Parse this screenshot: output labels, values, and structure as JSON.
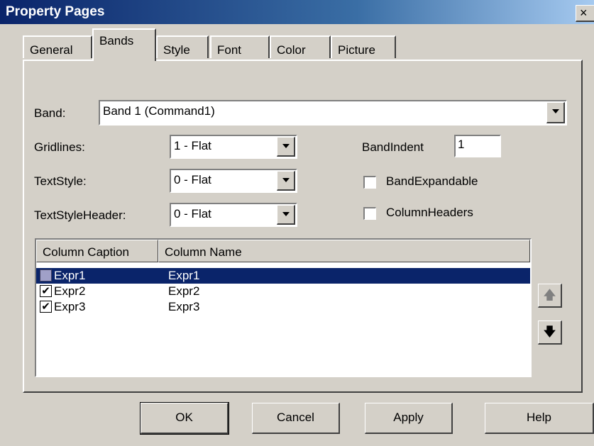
{
  "window": {
    "title": "Property Pages",
    "close_glyph": "×"
  },
  "tabs": [
    {
      "label": "General"
    },
    {
      "label": "Bands",
      "active": true
    },
    {
      "label": "Style"
    },
    {
      "label": "Font"
    },
    {
      "label": "Color"
    },
    {
      "label": "Picture"
    }
  ],
  "band": {
    "label": "Band:",
    "value": "Band 1 (Command1)"
  },
  "gridlines": {
    "label": "Gridlines:",
    "value": "1 - Flat"
  },
  "textstyle": {
    "label": "TextStyle:",
    "value": "0 - Flat"
  },
  "textstyle_header": {
    "label": "TextStyleHeader:",
    "value": "0 - Flat"
  },
  "band_indent": {
    "label": "BandIndent",
    "value": "1"
  },
  "band_expandable": {
    "label": "BandExpandable",
    "checked": false
  },
  "column_headers": {
    "label": "ColumnHeaders",
    "checked": false
  },
  "columns_list": {
    "headers": [
      "Column Caption",
      "Column Name"
    ],
    "rows": [
      {
        "caption": "Expr1",
        "name": "Expr1",
        "checked": false,
        "selected": true
      },
      {
        "caption": "Expr2",
        "name": "Expr2",
        "checked": true,
        "selected": false
      },
      {
        "caption": "Expr3",
        "name": "Expr3",
        "checked": true,
        "selected": false
      }
    ]
  },
  "move_buttons": {
    "up_icon": "arrow-up",
    "down_icon": "arrow-down"
  },
  "buttons": {
    "ok": "OK",
    "cancel": "Cancel",
    "apply": "Apply",
    "help": "Help"
  },
  "colors": {
    "selection": "#0a246a",
    "face": "#d4d0c8"
  }
}
